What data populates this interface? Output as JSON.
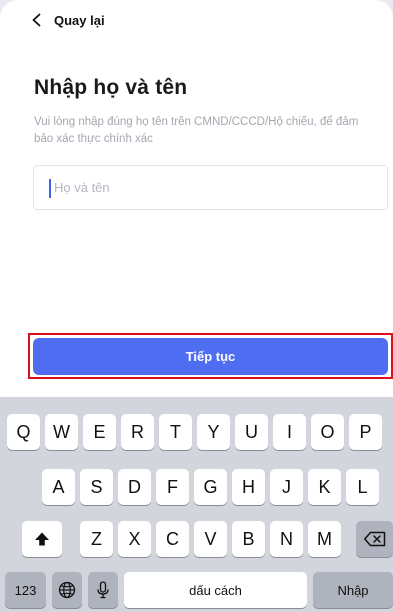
{
  "header": {
    "back_label": "Quay lại"
  },
  "form": {
    "title": "Nhập họ và tên",
    "subtitle": "Vui lòng nhập đúng họ tên trên CMND/CCCD/Hộ chiếu, để đảm bảo xác thực chính xác",
    "name_placeholder": "Họ và tên",
    "name_value": ""
  },
  "cta": {
    "label": "Tiếp tục",
    "highlight_color": "#e0101a",
    "button_color": "#4f6df0"
  },
  "keyboard": {
    "row1": [
      "Q",
      "W",
      "E",
      "R",
      "T",
      "Y",
      "U",
      "I",
      "O",
      "P"
    ],
    "row2": [
      "A",
      "S",
      "D",
      "F",
      "G",
      "H",
      "J",
      "K",
      "L"
    ],
    "row3": [
      "Z",
      "X",
      "C",
      "V",
      "B",
      "N",
      "M"
    ],
    "numbers_label": "123",
    "space_label": "dấu cách",
    "return_label": "Nhập",
    "icons": {
      "shift": "shift-arrow",
      "delete": "backspace",
      "globe": "globe",
      "mic": "microphone"
    }
  }
}
